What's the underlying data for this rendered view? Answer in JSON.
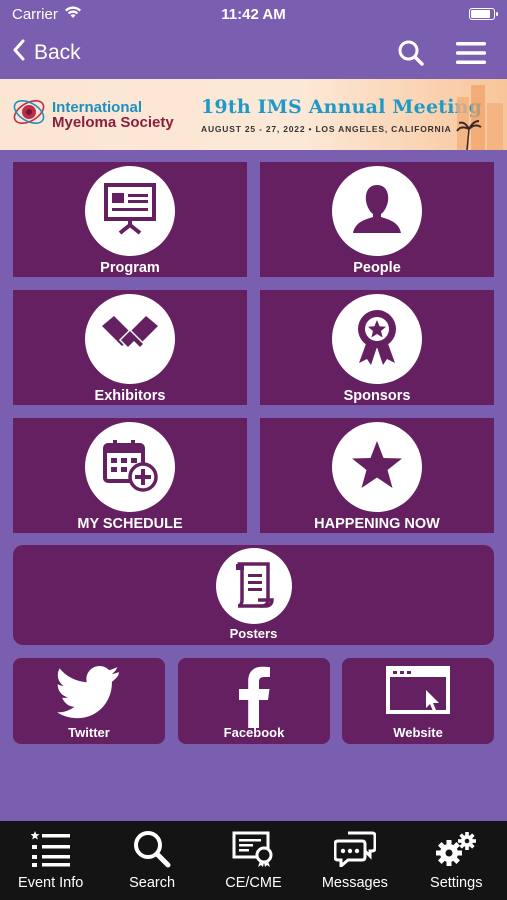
{
  "status_bar": {
    "carrier": "Carrier",
    "time": "11:42 AM"
  },
  "nav": {
    "back_label": "Back",
    "icons": [
      "search-icon",
      "menu-icon"
    ]
  },
  "banner": {
    "logo_line1": "International",
    "logo_line2": "Myeloma Society",
    "meeting_title": "19th IMS Annual Meeting",
    "meeting_subtitle": "AUGUST 25 - 27, 2022 • LOS ANGELES, CALIFORNIA"
  },
  "tiles": {
    "program": "Program",
    "people": "People",
    "exhibitors": "Exhibitors",
    "sponsors": "Sponsors",
    "my_schedule": "MY SCHEDULE",
    "happening_now": "HAPPENING NOW",
    "posters": "Posters",
    "twitter": "Twitter",
    "facebook": "Facebook",
    "website": "Website"
  },
  "tab_bar": [
    {
      "label": "Event Info",
      "icon": "list-star-icon"
    },
    {
      "label": "Search",
      "icon": "search-icon"
    },
    {
      "label": "CE/CME",
      "icon": "certificate-icon"
    },
    {
      "label": "Messages",
      "icon": "chat-bubbles-icon"
    },
    {
      "label": "Settings",
      "icon": "gears-icon"
    }
  ],
  "colors": {
    "background": "#7a5fb0",
    "tile": "#652062",
    "tab_bar": "#141414",
    "logo_blue": "#1f8fbf",
    "logo_red": "#8a1e3c"
  }
}
